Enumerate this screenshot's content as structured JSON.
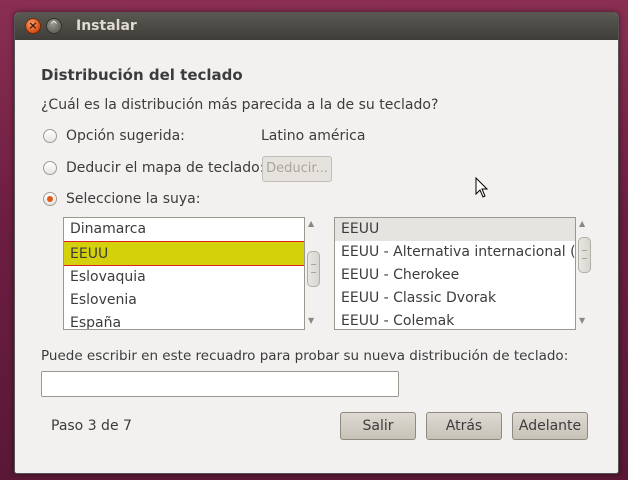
{
  "window": {
    "title": "Instalar",
    "close_glyph": "×",
    "max_glyph": "^"
  },
  "page": {
    "heading": "Distribución del teclado",
    "question": "¿Cuál es la distribución más parecida a la de su teclado?"
  },
  "options": {
    "suggested_label": "Opción sugerida:",
    "suggested_value": "Latino américa",
    "deduce_label": "Deducir el mapa de teclado:",
    "deduce_button": "Deducir...",
    "choose_label": "Seleccione la suya:",
    "selected_option": "choose"
  },
  "layouts": {
    "items": [
      "Dinamarca",
      "EEUU",
      "Eslovaquia",
      "Eslovenia",
      "España"
    ],
    "selected": "EEUU"
  },
  "variants": {
    "items": [
      "EEUU",
      "EEUU - Alternativa internacional (ar",
      "EEUU - Cherokee",
      "EEUU - Classic Dvorak",
      "EEUU - Colemak"
    ],
    "selected": "EEUU"
  },
  "test": {
    "hint": "Puede escribir en este recuadro para probar su nueva distribución de teclado:",
    "value": ""
  },
  "footer": {
    "step": "Paso 3 de 7",
    "quit": "Salir",
    "back": "Atrás",
    "forward": "Adelante"
  },
  "colors": {
    "highlight": "#d4d00a",
    "highlight_border": "#e02020",
    "radio_accent": "#e05a1a"
  }
}
